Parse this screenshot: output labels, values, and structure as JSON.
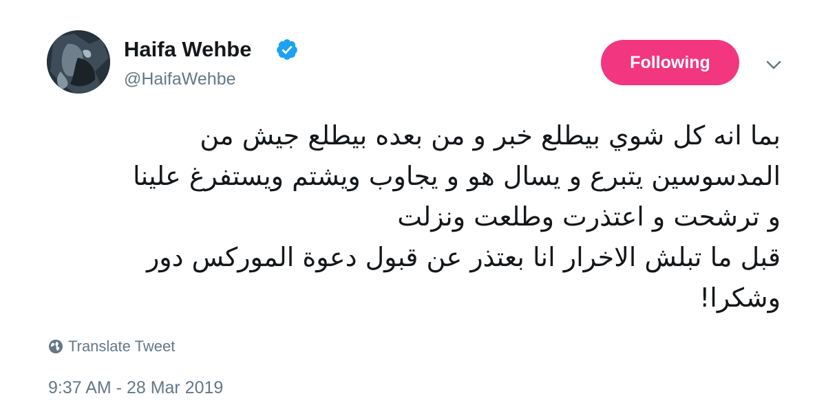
{
  "user": {
    "display_name": "Haifa Wehbe",
    "handle": "@HaifaWehbe",
    "verified": true
  },
  "follow_button": {
    "label": "Following",
    "color": "#f23680"
  },
  "tweet": {
    "lines": [
      "بما انه كل شوي بيطلع خبر و من بعده بيطلع جيش من",
      "المدسوسين يتبرع و يسال هو و يجاوب ويشتم  ويستفرغ علينا",
      "و ترشحت و اعتذرت وطلعت ونزلت",
      "قبل ما تبلش الاخرار انا بعتذر عن قبول دعوة الموركس دور",
      "وشكرا!"
    ]
  },
  "translate": {
    "label": "Translate Tweet",
    "icon": "globe-icon"
  },
  "timestamp": "9:37 AM - 28 Mar 2019",
  "colors": {
    "text_primary": "#14171a",
    "text_secondary": "#657786",
    "verified_blue": "#1da1f2"
  }
}
